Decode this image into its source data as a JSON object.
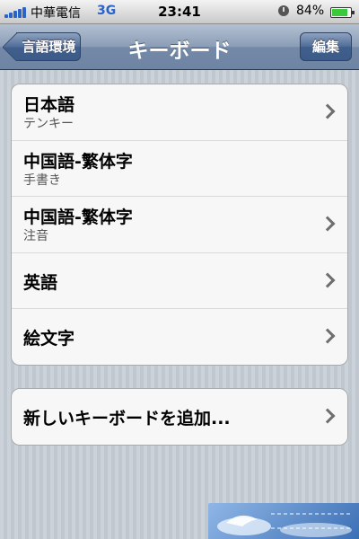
{
  "status_bar": {
    "carrier": "中華電信",
    "network": "3G",
    "time": "23:41",
    "battery": "84%"
  },
  "nav": {
    "back_label": "言語環境",
    "title": "キーボード",
    "edit_label": "編集"
  },
  "keyboards": [
    {
      "name": "日本語",
      "subtitle": "テンキー",
      "chevron": true
    },
    {
      "name": "中国語-繁体字",
      "subtitle": "手書き",
      "chevron": false
    },
    {
      "name": "中国語-繁体字",
      "subtitle": "注音",
      "chevron": true
    },
    {
      "name": "英語",
      "subtitle": "",
      "chevron": true
    },
    {
      "name": "絵文字",
      "subtitle": "",
      "chevron": true
    }
  ],
  "add_keyboard": {
    "label": "新しいキーボードを追加..."
  },
  "icons": {
    "back": "back-arrow-icon",
    "chevron": "chevron-right-icon",
    "lock": "rotation-lock-icon",
    "battery": "battery-icon",
    "signal": "signal-bars-icon"
  },
  "colors": {
    "nav_bar": "#6d84a2",
    "network": "#2a64c8",
    "battery_fill": "#3bc83b",
    "background": "#c5ccd4"
  }
}
